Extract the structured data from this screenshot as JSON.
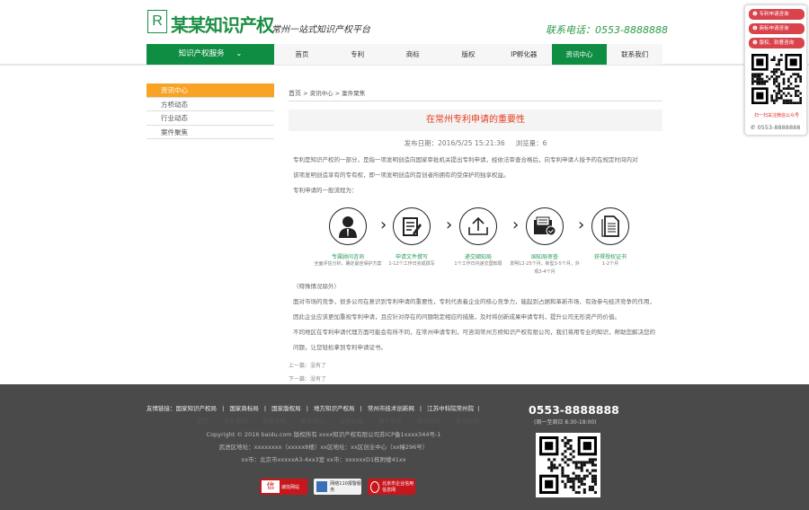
{
  "header": {
    "logo_letter": "R",
    "logo_text": "某某知识产权",
    "slogan": "常州一站式知识产权平台",
    "hotline": "联系电话：0553-8888888"
  },
  "nav": {
    "service_label": "知识产权服务",
    "items": [
      "首页",
      "专利",
      "商标",
      "版权",
      "IP孵化器",
      "资讯中心",
      "联系我们"
    ],
    "active": 5
  },
  "sidebar": {
    "items": [
      "资讯中心",
      "方桥动态",
      "行业动态",
      "案件聚焦"
    ]
  },
  "breadcrumb": {
    "home": "首页",
    "sep": " > ",
    "level1": "资讯中心",
    "level2": "案件聚焦"
  },
  "article": {
    "title": "在常州专利申请的重要性",
    "date": "发布日期：2016/5/25 15:21:36",
    "views": "浏览量：6",
    "intro": [
      "专利是知识产权的一部分，是指一项发明创造向国家审批机关提出专利申请，经依法审查合格后，向专利申请人授予的在规定时间内对",
      "该项发明创造享有的专有权，即一项发明创造的首创者所拥有的受保护的独享权益。",
      "专利申请的一般流程为："
    ],
    "steps": [
      {
        "label": "专属顾问咨询",
        "desc": "全面评估分析，确定最佳保护方案",
        "icon": "consultant-icon"
      },
      {
        "label": "申请文件撰写",
        "desc": "1-12个工作日完成撰写",
        "icon": "document-edit-icon"
      },
      {
        "label": "递交國知局",
        "desc": "1个工作日内递交国知局",
        "icon": "upload-icon"
      },
      {
        "label": "国知局审查",
        "desc": "发明12-25个月，新型3-5个月，外观3-4个月",
        "icon": "review-icon"
      },
      {
        "label": "获得授权证书",
        "desc": "1-2个月",
        "icon": "certificate-icon"
      }
    ],
    "note": "（特殊情况除外）",
    "body": [
      "面对市场的竞争，很多公司在意识到专利申请的重要性，专利代表着企业的核心竞争力，能起到占据和革新市场、有效参与经济竞争的作用，",
      "因此企业应该更加重视专利申请，且应针对存在的问题制定相应的措施，及时将创新成果申请专利，提升公司无形资产的价值。",
      "不同地区在专利申请代理方面可能会有所不同，在常州申请专利，可咨询常州方桥知识产权有限公司，我们将用专业的知识，帮助您解决您的",
      "问题，让您轻松拿到专利申请证书。"
    ],
    "prev": "上一篇：没有了",
    "next": "下一篇：没有了"
  },
  "footer": {
    "links_label": "友情链接：",
    "links": [
      "国家知识产权局",
      "国家商标局",
      "国家版权局",
      "地方知识产权局",
      "常州市技术创新网",
      "江苏中科院常州院"
    ],
    "nav": [
      "首页",
      "关于我们",
      "最新优惠",
      "联系我们",
      "合作加盟",
      "用户协议",
      "支付方式",
      "售后服务"
    ],
    "copyright": "Copyright © 2016 baidu.com 版权所有  xxxx知识产权有限公司苏ICP备1xxxx344号-1",
    "address1": "武进区地址：xxxxxxxx（xxxxx8楼）xx区地址：xx区创业中心（xx幢296号）",
    "address2": "xx市：北京市xxxxxA3-4xx3室 xx市：xxxxxxD1栋附楼41xx",
    "badges": [
      "诚信网站",
      "网络110报警服务",
      "北京市企业信用信息网"
    ],
    "phone": "0553-8888888",
    "hours": "(周一至周日 8:30-18:00)"
  },
  "float_panel": {
    "buttons": [
      "专利申请咨询",
      "商标申请咨询",
      "版权、软著咨询"
    ],
    "scan_text": "扫一扫关注微信公众号",
    "phone": "0553-8888888"
  },
  "colors": {
    "green": "#0f8d43",
    "orange": "#f9a324",
    "red": "#e83b1d",
    "footer": "#4a4a4a"
  }
}
